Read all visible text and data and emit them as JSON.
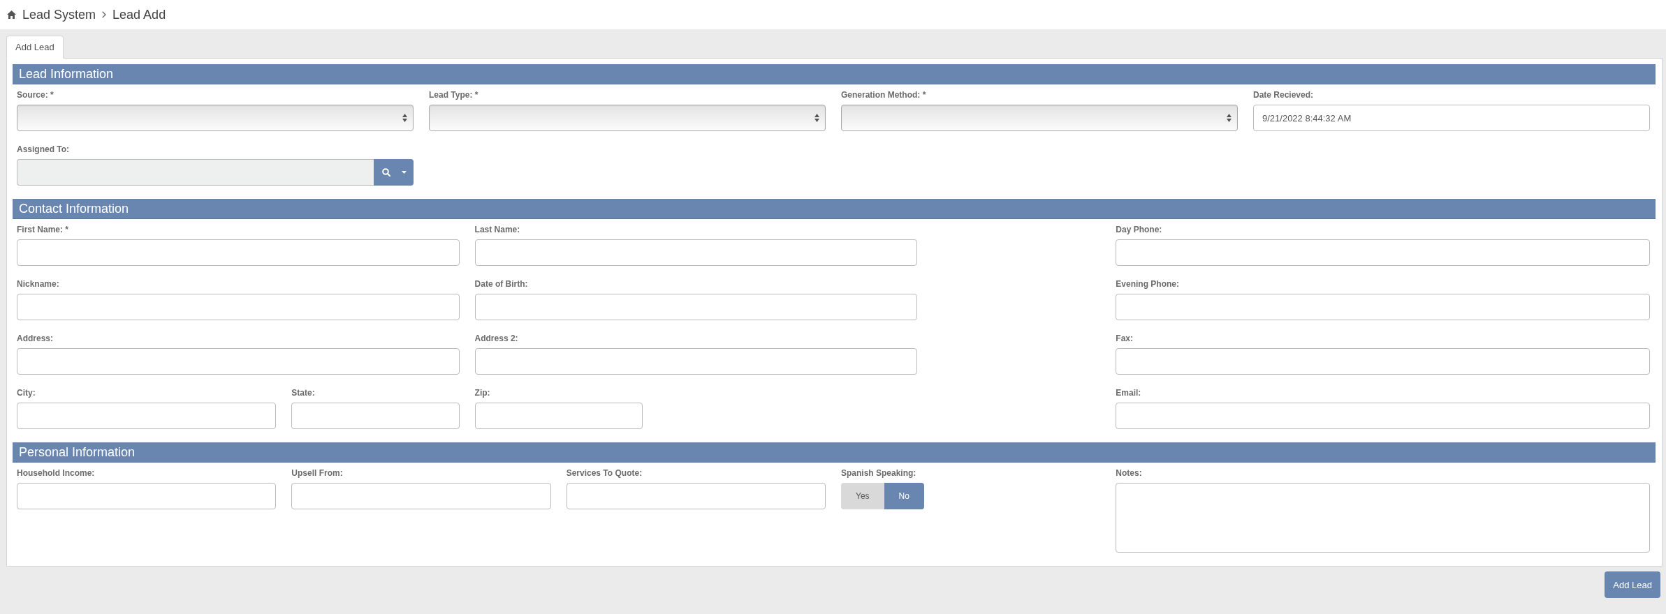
{
  "breadcrumb": [
    "Lead System",
    "Lead Add"
  ],
  "tabs": [
    {
      "label": "Add Lead",
      "selected": true
    }
  ],
  "sections": [
    {
      "title": "Lead Information",
      "fields": [
        {
          "label": "Source: *",
          "kind": "select"
        },
        {
          "label": "Lead Type: *",
          "kind": "select"
        },
        {
          "label": "Generation Method: *",
          "kind": "select"
        },
        {
          "label": "Date Recieved:",
          "kind": "text",
          "value": "9/21/2022 8:44:32 AM"
        },
        {
          "label": "Assigned To:",
          "kind": "lookup",
          "readonly": true
        }
      ]
    },
    {
      "title": "Contact Information",
      "fields": [
        {
          "label": "First Name: *",
          "kind": "text"
        },
        {
          "label": "Last Name:",
          "kind": "text"
        },
        {
          "label": "Day Phone:",
          "kind": "text"
        },
        {
          "label": "Nickname:",
          "kind": "text"
        },
        {
          "label": "Date of Birth:",
          "kind": "text"
        },
        {
          "label": "Evening Phone:",
          "kind": "text"
        },
        {
          "label": "Address:",
          "kind": "text"
        },
        {
          "label": "Address 2:",
          "kind": "text"
        },
        {
          "label": "Fax:",
          "kind": "text"
        },
        {
          "label": "City:",
          "kind": "text"
        },
        {
          "label": "State:",
          "kind": "text"
        },
        {
          "label": "Zip:",
          "kind": "text"
        },
        {
          "label": "Email:",
          "kind": "text"
        }
      ]
    },
    {
      "title": "Personal Information",
      "fields": [
        {
          "label": "Household Income:",
          "kind": "text"
        },
        {
          "label": "Upsell From:",
          "kind": "text"
        },
        {
          "label": "Services To Quote:",
          "kind": "text"
        },
        {
          "label": "Spanish Speaking:",
          "kind": "toggle",
          "options": [
            {
              "label": "Yes",
              "selected": false
            },
            {
              "label": "No",
              "selected": true
            }
          ]
        },
        {
          "label": "Notes:",
          "kind": "textarea"
        }
      ]
    }
  ],
  "submit_button": {
    "label": "Add Lead"
  }
}
